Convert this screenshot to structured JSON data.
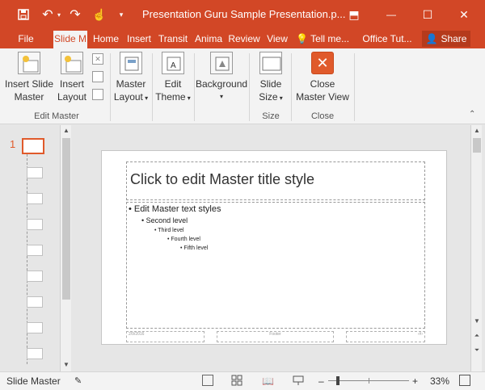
{
  "window": {
    "title": "Presentation Guru Sample Presentation.p...",
    "controls": {
      "ribbon_display": "⬒",
      "minimize": "—",
      "maximize": "☐",
      "close": "✕"
    }
  },
  "qat": {
    "save_icon": "save-icon",
    "undo_icon": "undo-icon",
    "redo_icon": "redo-icon",
    "touch_icon": "touch-mode-icon",
    "customize_icon": "customize-qat-icon"
  },
  "tabs": [
    "File",
    "Slide M",
    "Home",
    "Insert",
    "Transit",
    "Anima",
    "Review",
    "View"
  ],
  "tell_me": "Tell me...",
  "office_tut": "Office Tut...",
  "share_label": "Share",
  "ribbon": {
    "insert_slide_master": {
      "line1": "Insert Slide",
      "line2": "Master"
    },
    "insert_layout": {
      "line1": "Insert",
      "line2": "Layout"
    },
    "edit_master_group": "Edit Master",
    "master_layout": {
      "line1": "Master",
      "line2": "Layout"
    },
    "edit_theme": {
      "line1": "Edit",
      "line2": "Theme"
    },
    "background": {
      "line1": "Background"
    },
    "slide_size": {
      "line1": "Slide",
      "line2": "Size"
    },
    "size_group": "Size",
    "close_master_view": {
      "line1": "Close",
      "line2": "Master View"
    },
    "close_group": "Close"
  },
  "thumbnails": {
    "selected_number": "1",
    "count": 9
  },
  "slide": {
    "title_placeholder": "Click to edit Master title style",
    "levels": [
      "• Edit Master text styles",
      "• Second level",
      "• Third level",
      "• Fourth level",
      "• Fifth level"
    ],
    "footer_date": "2/9/2016",
    "footer_text": "Footer",
    "footer_num": "‹#›"
  },
  "status": {
    "view_name": "Slide Master",
    "zoom_minus": "–",
    "zoom_plus": "+",
    "zoom": "33%",
    "zoom_level_fraction": 0.33
  },
  "colors": {
    "brand": "#d24726",
    "accent_close": "#e05a2b"
  }
}
